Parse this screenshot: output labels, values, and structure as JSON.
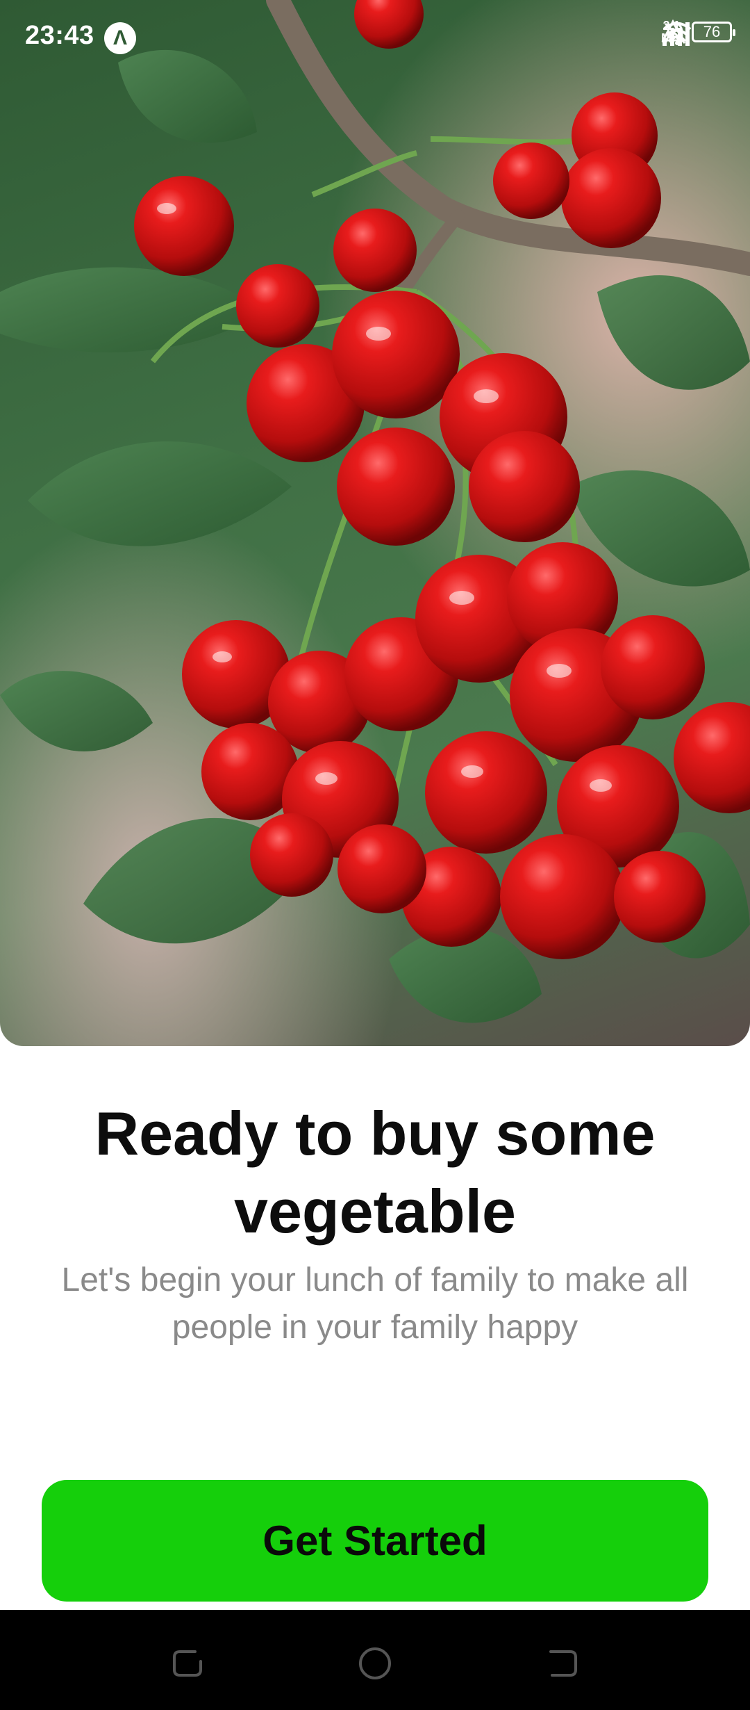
{
  "status_bar": {
    "time": "23:43",
    "app_badge_letter": "Λ",
    "speed_value": "2,1",
    "speed_unit": "M/s",
    "battery": "76",
    "icons": [
      "notifications-off-icon",
      "wifi-icon",
      "signal-icon",
      "signal-icon",
      "warning-icon",
      "battery-icon"
    ]
  },
  "hero": {
    "image_subject_icon": "cherries-image"
  },
  "content": {
    "title": "Ready to buy some vegetable",
    "subtitle": "Let's begin your lunch of family to make all people in your family happy"
  },
  "cta": {
    "label": "Get Started",
    "color": "#15cf0b"
  },
  "nav_bar": {
    "icons": [
      "recents-icon",
      "home-icon",
      "back-icon"
    ]
  }
}
